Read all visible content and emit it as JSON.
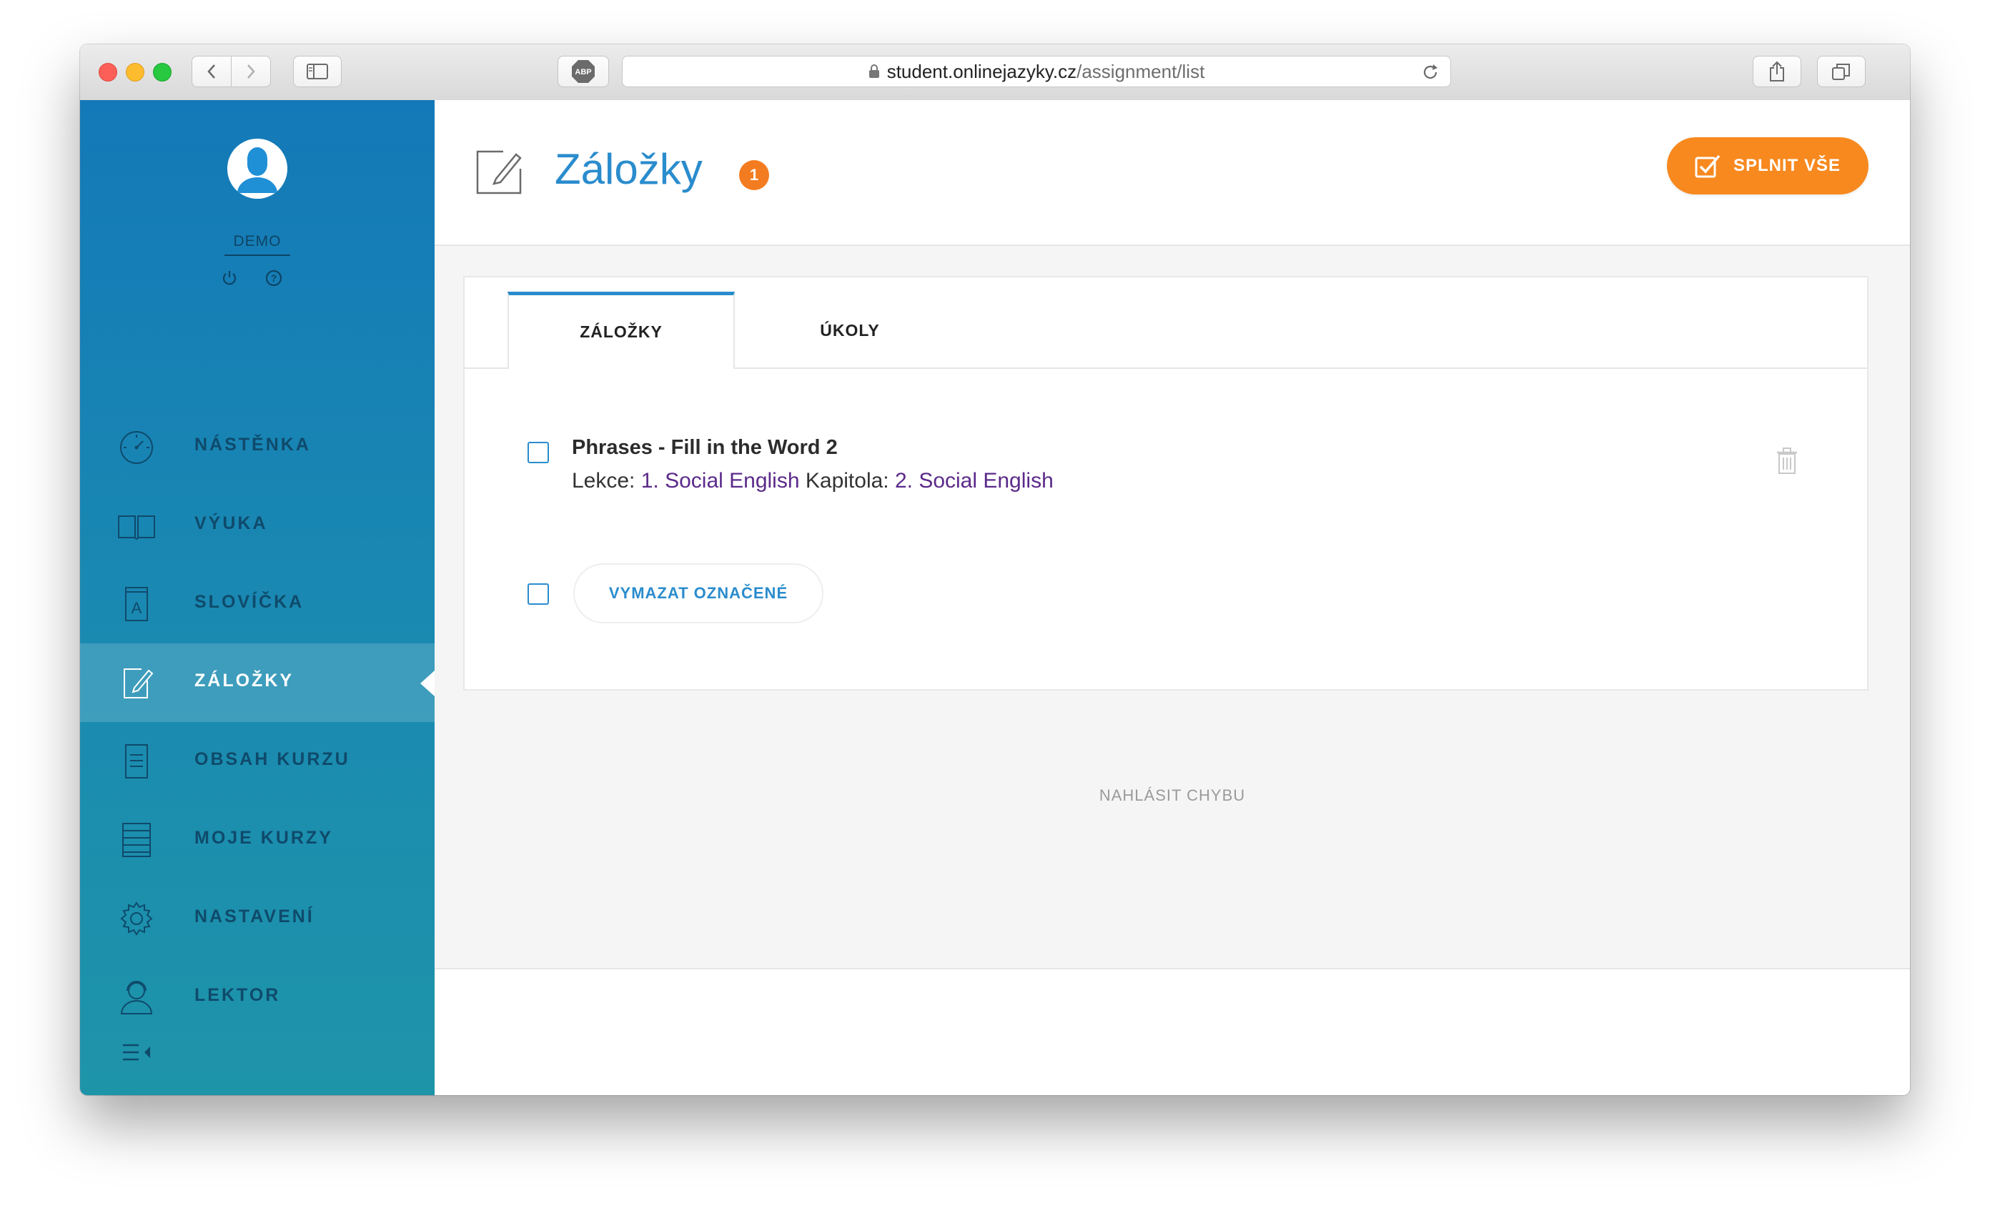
{
  "browser": {
    "url_host": "student.onlinejazyky.cz",
    "url_path": "/assignment/list",
    "adblock_label": "ABP"
  },
  "sidebar": {
    "user_name": "DEMO",
    "items": [
      {
        "label": "NÁSTĚNKA",
        "icon": "dashboard-icon"
      },
      {
        "label": "VÝUKA",
        "icon": "book-icon"
      },
      {
        "label": "SLOVÍČKA",
        "icon": "vocabulary-icon"
      },
      {
        "label": "ZÁLOŽKY",
        "icon": "edit-icon",
        "active": true
      },
      {
        "label": "OBSAH KURZU",
        "icon": "document-icon"
      },
      {
        "label": "MOJE KURZY",
        "icon": "list-icon"
      },
      {
        "label": "NASTAVENÍ",
        "icon": "gear-icon"
      },
      {
        "label": "LEKTOR",
        "icon": "tutor-icon"
      }
    ]
  },
  "header": {
    "title": "Záložky",
    "count": "1",
    "complete_all_label": "SPLNIT VŠE"
  },
  "tabs": [
    {
      "label": "ZÁLOŽKY",
      "active": true
    },
    {
      "label": "ÚKOLY",
      "active": false
    }
  ],
  "bookmarks": [
    {
      "title": "Phrases - Fill in the Word 2",
      "lesson_label": "Lekce:",
      "lesson": "1. Social English",
      "chapter_label": "Kapitola:",
      "chapter": "2. Social English"
    }
  ],
  "actions": {
    "delete_selected_label": "VYMAZAT OZNAČENÉ"
  },
  "footer": {
    "report_error_label": "NAHLÁSIT CHYBU"
  },
  "colors": {
    "accent_blue": "#2a8ccd",
    "accent_orange": "#f7891f",
    "sidebar_top": "#1479b8",
    "sidebar_bottom": "#1e94a9",
    "link_purple": "#5b2a8a"
  }
}
